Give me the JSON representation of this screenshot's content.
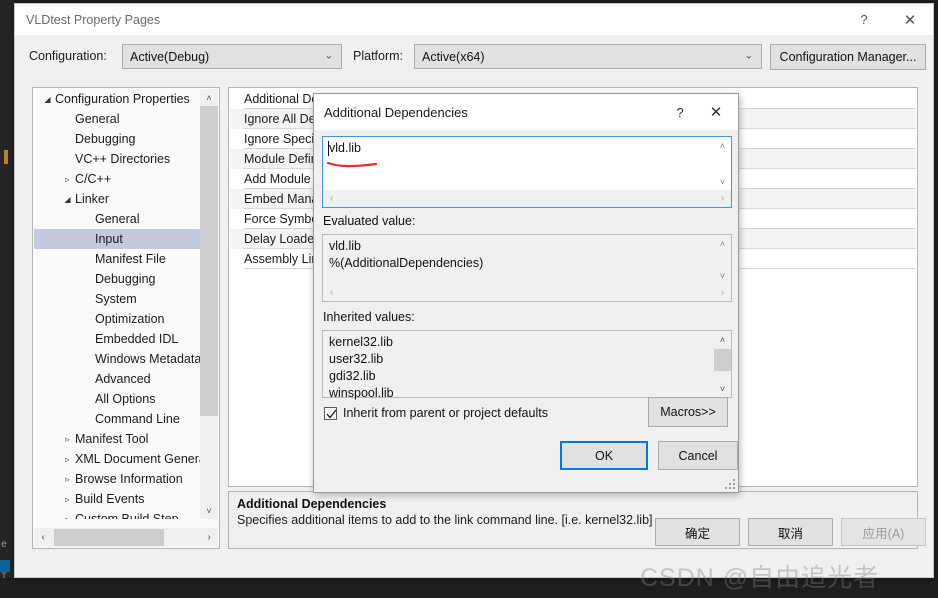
{
  "window": {
    "title": "VLDtest Property Pages",
    "help_icon": "?",
    "close_icon": "✕"
  },
  "config_bar": {
    "configuration_label": "Configuration:",
    "configuration_value": "Active(Debug)",
    "platform_label": "Platform:",
    "platform_value": "Active(x64)",
    "configuration_manager_label": "Configuration Manager...",
    "dropdown_icon": "⌄"
  },
  "tree": {
    "items": [
      {
        "label": "Configuration Properties",
        "indent": 0,
        "twisty": "◢",
        "selected": false
      },
      {
        "label": "General",
        "indent": 1,
        "twisty": "",
        "selected": false
      },
      {
        "label": "Debugging",
        "indent": 1,
        "twisty": "",
        "selected": false
      },
      {
        "label": "VC++ Directories",
        "indent": 1,
        "twisty": "",
        "selected": false
      },
      {
        "label": "C/C++",
        "indent": 1,
        "twisty": "▹",
        "selected": false
      },
      {
        "label": "Linker",
        "indent": 1,
        "twisty": "◢",
        "selected": false
      },
      {
        "label": "General",
        "indent": 2,
        "twisty": "",
        "selected": false
      },
      {
        "label": "Input",
        "indent": 2,
        "twisty": "",
        "selected": true
      },
      {
        "label": "Manifest File",
        "indent": 2,
        "twisty": "",
        "selected": false
      },
      {
        "label": "Debugging",
        "indent": 2,
        "twisty": "",
        "selected": false
      },
      {
        "label": "System",
        "indent": 2,
        "twisty": "",
        "selected": false
      },
      {
        "label": "Optimization",
        "indent": 2,
        "twisty": "",
        "selected": false
      },
      {
        "label": "Embedded IDL",
        "indent": 2,
        "twisty": "",
        "selected": false
      },
      {
        "label": "Windows Metadata",
        "indent": 2,
        "twisty": "",
        "selected": false
      },
      {
        "label": "Advanced",
        "indent": 2,
        "twisty": "",
        "selected": false
      },
      {
        "label": "All Options",
        "indent": 2,
        "twisty": "",
        "selected": false
      },
      {
        "label": "Command Line",
        "indent": 2,
        "twisty": "",
        "selected": false
      },
      {
        "label": "Manifest Tool",
        "indent": 1,
        "twisty": "▹",
        "selected": false
      },
      {
        "label": "XML Document Generator",
        "indent": 1,
        "twisty": "▹",
        "selected": false
      },
      {
        "label": "Browse Information",
        "indent": 1,
        "twisty": "▹",
        "selected": false
      },
      {
        "label": "Build Events",
        "indent": 1,
        "twisty": "▹",
        "selected": false
      },
      {
        "label": "Custom Build Step",
        "indent": 1,
        "twisty": "▹",
        "selected": false
      }
    ],
    "scroll_up_icon": "˄",
    "scroll_down_icon": "˅",
    "scroll_left_icon": "‹",
    "scroll_right_icon": "›"
  },
  "grid": {
    "rows": [
      {
        "name": "Additional Dependencies",
        "value": "vld.lib;%(AdditionalDependencies)"
      },
      {
        "name": "Ignore All Default Libraries",
        "value": ""
      },
      {
        "name": "Ignore Specific Default Libraries",
        "value": ""
      },
      {
        "name": "Module Definition File",
        "value": ""
      },
      {
        "name": "Add Module to Assembly",
        "value": ""
      },
      {
        "name": "Embed Managed Resource File",
        "value": ""
      },
      {
        "name": "Force Symbol References",
        "value": ""
      },
      {
        "name": "Delay Loaded Dlls",
        "value": ""
      },
      {
        "name": "Assembly Link Resource",
        "value": ""
      }
    ]
  },
  "description": {
    "title": "Additional Dependencies",
    "body": "Specifies additional items to add to the link command line. [i.e. kernel32.lib]"
  },
  "footer": {
    "ok_label": "确定",
    "cancel_label": "取消",
    "apply_label": "应用(A)"
  },
  "dialog": {
    "title": "Additional Dependencies",
    "help_icon": "?",
    "close_icon": "✕",
    "edit_value": "vld.lib",
    "evaluated_label": "Evaluated value:",
    "evaluated_lines": "vld.lib\n%(AdditionalDependencies)",
    "inherited_label": "Inherited values:",
    "inherited_lines": "kernel32.lib\nuser32.lib\ngdi32.lib\nwinspool.lib",
    "inherit_checkbox_label": "Inherit from parent or project defaults",
    "inherit_checked": true,
    "macros_label": "Macros>>",
    "ok_label": "OK",
    "cancel_label": "Cancel",
    "scroll_up_icon": "˄",
    "scroll_down_icon": "˅",
    "scroll_left_icon": "‹",
    "scroll_right_icon": "›"
  },
  "watermark": {
    "text": "CSDN @自由追光者"
  },
  "colors": {
    "accent_blue": "#0078D7",
    "edit_border_blue": "#3D9BDC",
    "selection": "#C6C9DD",
    "annotation_red": "#E03030",
    "window_bg": "#F0F0F0",
    "backdrop_dark": "#1E1E1E"
  }
}
